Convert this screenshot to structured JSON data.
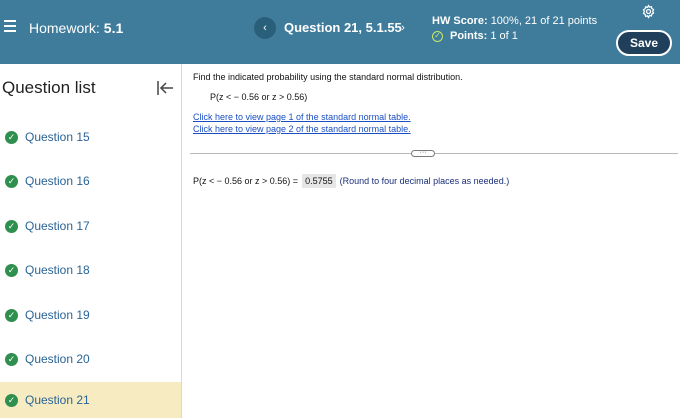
{
  "header": {
    "hw_label": "Homework:",
    "hw_number": "5.1",
    "question_title": "Question 21, 5.1.55",
    "prev_icon": "‹",
    "next_icon": "›",
    "score_label": "HW Score:",
    "score_value": "100%, 21 of 21 points",
    "points_label": "Points:",
    "points_value": "1 of 1",
    "save_label": "Save",
    "colors": {
      "bar": "#3f7c9b",
      "save_bg": "#1f3f5b"
    }
  },
  "sidebar": {
    "title": "Question list",
    "items": [
      {
        "label": "Question 15",
        "status": "correct"
      },
      {
        "label": "Question 16",
        "status": "correct"
      },
      {
        "label": "Question 17",
        "status": "correct"
      },
      {
        "label": "Question 18",
        "status": "correct"
      },
      {
        "label": "Question 19",
        "status": "correct"
      },
      {
        "label": "Question 20",
        "status": "correct"
      },
      {
        "label": "Question 21",
        "status": "correct",
        "active": true
      }
    ],
    "colors": {
      "check": "#2f8f4e",
      "active_bg": "#f7ebc1",
      "label": "#2a6496"
    }
  },
  "main": {
    "prompt": "Find the indicated probability using the standard normal distribution.",
    "expression": "P(z <  − 0.56 or z > 0.56)",
    "link1": "Click here to view page 1 of the standard normal table.",
    "link2": "Click here to view page 2 of the standard normal table.",
    "answer_prefix": "P(z <  − 0.56 or z > 0.56) =",
    "answer_value": "0.5755",
    "answer_hint": "(Round to four decimal places as needed.)"
  }
}
